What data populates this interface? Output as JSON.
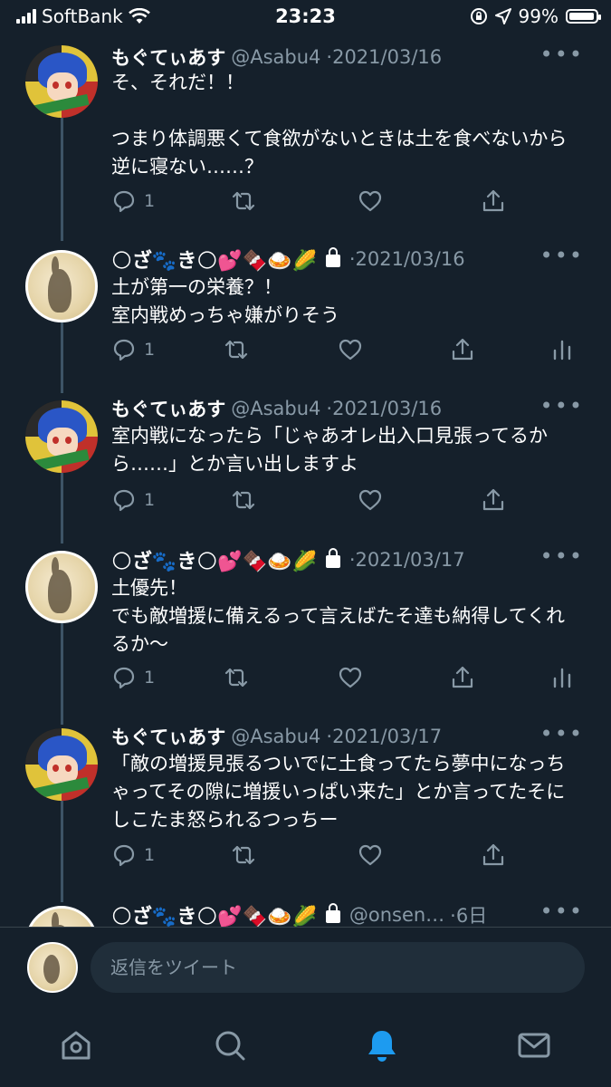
{
  "status_bar": {
    "carrier": "SoftBank",
    "time": "23:23",
    "battery": "99%"
  },
  "tweets": [
    {
      "avatar": "anime-character-avatar",
      "name": "もぐてぃあす",
      "handle": "@Asabu4",
      "date": "·2021/03/16",
      "text": "そ、それだ！！\n\nつまり体調悪くて食欲がないときは土を食べないから逆に寝ない……？",
      "replies": "1"
    },
    {
      "avatar": "moon-rabbit-avatar",
      "name_emoji": "🌕ざ🐾き🌕💕🍫🍛🌽",
      "date": "·2021/03/16",
      "text": "土が第一の栄養？！\n室内戦めっちゃ嫌がりそう",
      "replies": "1"
    },
    {
      "avatar": "anime-character-avatar",
      "name": "もぐてぃあす",
      "handle": "@Asabu4",
      "date": "·2021/03/16",
      "text": "室内戦になったら「じゃあオレ出入口見張ってるから……」とか言い出しますよ",
      "replies": "1"
    },
    {
      "avatar": "moon-rabbit-avatar",
      "name_emoji": "🌕ざ🐾き🌕💕🍫🍛🌽",
      "date": "·2021/03/17",
      "text": "土優先！\nでも敵増援に備えるって言えばたそ達も納得してくれるか〜",
      "replies": "1"
    },
    {
      "avatar": "anime-character-avatar",
      "name": "もぐてぃあす",
      "handle": "@Asabu4",
      "date": "·2021/03/17",
      "text": "「敵の増援見張るついでに土食ってたら夢中になっちゃってその隙に増援いっぱい来た」とか言ってたそにしこたま怒られるつっちー",
      "replies": "1"
    },
    {
      "avatar": "moon-rabbit-avatar",
      "name_emoji": "🌕ざ🐾き🌕💕🍫🍛🌽",
      "handle": "@onsen…",
      "date": "·6日"
    }
  ],
  "reply_bar": {
    "placeholder": "返信をツイート"
  },
  "tabs": [
    "home-icon",
    "search-icon",
    "notifications-icon",
    "messages-icon"
  ],
  "colors": {
    "background": "#15202b",
    "secondary_text": "#8899a6",
    "accent": "#1d9bf0"
  }
}
